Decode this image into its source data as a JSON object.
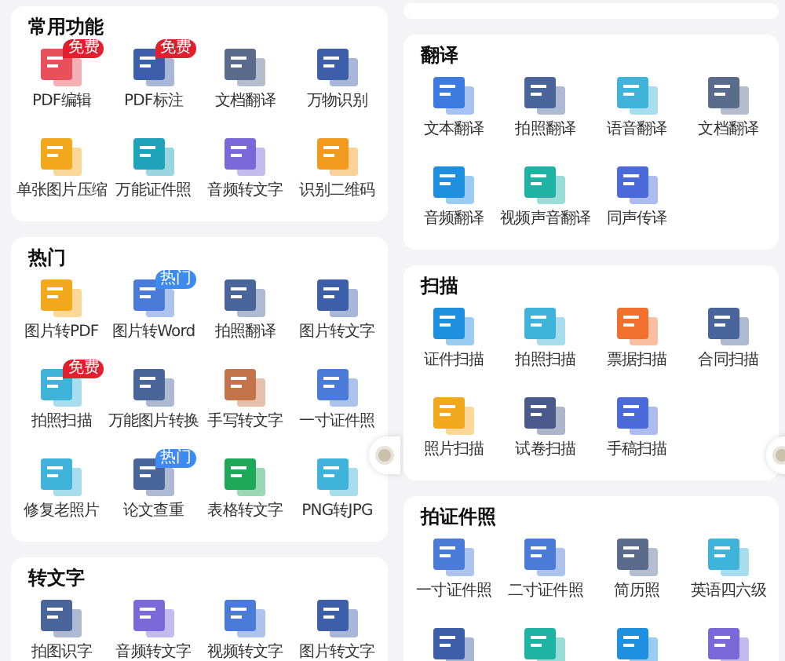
{
  "left_column": [
    {
      "title": "常用功能",
      "items": [
        {
          "label": "PDF编辑",
          "color": "#e8505b",
          "badge": {
            "text": "免费",
            "kind": "free"
          }
        },
        {
          "label": "PDF标注",
          "color": "#3d5ea8",
          "badge": {
            "text": "免费",
            "kind": "free"
          }
        },
        {
          "label": "文档翻译",
          "color": "#5a6b8c"
        },
        {
          "label": "万物识别",
          "color": "#3d5ea8"
        },
        {
          "label": "单张图片压缩",
          "color": "#f2a81d"
        },
        {
          "label": "万能证件照",
          "color": "#1fa3b8"
        },
        {
          "label": "音频转文字",
          "color": "#7b68d9"
        },
        {
          "label": "识别二维码",
          "color": "#f29a1d"
        }
      ]
    },
    {
      "title": "热门",
      "items": [
        {
          "label": "图片转PDF",
          "color": "#f2a81d"
        },
        {
          "label": "图片转Word",
          "color": "#4a7bd9",
          "badge": {
            "text": "热门",
            "kind": "hot"
          }
        },
        {
          "label": "拍照翻译",
          "color": "#4a6599"
        },
        {
          "label": "图片转文字",
          "color": "#3d5ea8"
        },
        {
          "label": "拍照扫描",
          "color": "#3fb3d9",
          "badge": {
            "text": "免费",
            "kind": "free"
          }
        },
        {
          "label": "万能图片转换",
          "color": "#4a6599"
        },
        {
          "label": "手写转文字",
          "color": "#c4744a"
        },
        {
          "label": "一寸证件照",
          "color": "#4a7bd9"
        },
        {
          "label": "修复老照片",
          "color": "#3fb3d9"
        },
        {
          "label": "论文查重",
          "color": "#4a6599",
          "badge": {
            "text": "热门",
            "kind": "hot"
          }
        },
        {
          "label": "表格转文字",
          "color": "#1fa85a"
        },
        {
          "label": "PNG转JPG",
          "color": "#3fb3d9"
        }
      ]
    },
    {
      "title": "转文字",
      "items": [
        {
          "label": "拍图识字",
          "color": "#4a6599"
        },
        {
          "label": "音频转文字",
          "color": "#7b68d9"
        },
        {
          "label": "视频转文字",
          "color": "#4a7bd9"
        },
        {
          "label": "图片转文字",
          "color": "#3d5ea8"
        }
      ]
    }
  ],
  "right_column": [
    {
      "title": "翻译",
      "items": [
        {
          "label": "文本翻译",
          "color": "#3d7be0"
        },
        {
          "label": "拍照翻译",
          "color": "#4a6599"
        },
        {
          "label": "语音翻译",
          "color": "#3fb3d9"
        },
        {
          "label": "文档翻译",
          "color": "#5a6b8c"
        },
        {
          "label": "音频翻译",
          "color": "#1f8fe0"
        },
        {
          "label": "视频声音翻译",
          "color": "#1fb3a3"
        },
        {
          "label": "同声传译",
          "color": "#4a6ad9"
        }
      ]
    },
    {
      "title": "扫描",
      "items": [
        {
          "label": "证件扫描",
          "color": "#1f8fe0"
        },
        {
          "label": "拍照扫描",
          "color": "#3fb3d9"
        },
        {
          "label": "票据扫描",
          "color": "#f2702d"
        },
        {
          "label": "合同扫描",
          "color": "#4a6599"
        },
        {
          "label": "照片扫描",
          "color": "#f2a81d"
        },
        {
          "label": "试卷扫描",
          "color": "#4a5a8c"
        },
        {
          "label": "手稿扫描",
          "color": "#4a6ad9"
        }
      ]
    },
    {
      "title": "拍证件照",
      "items": [
        {
          "label": "一寸证件照",
          "color": "#4a7bd9"
        },
        {
          "label": "二寸证件照",
          "color": "#4a7bd9"
        },
        {
          "label": "简历照",
          "color": "#5a6b8c"
        },
        {
          "label": "英语四六级",
          "color": "#3fb3d9"
        },
        {
          "color": "#3d5ea8"
        },
        {
          "color": "#1fb3a3"
        },
        {
          "color": "#1f8fe0"
        },
        {
          "color": "#7b68d9"
        }
      ]
    }
  ]
}
